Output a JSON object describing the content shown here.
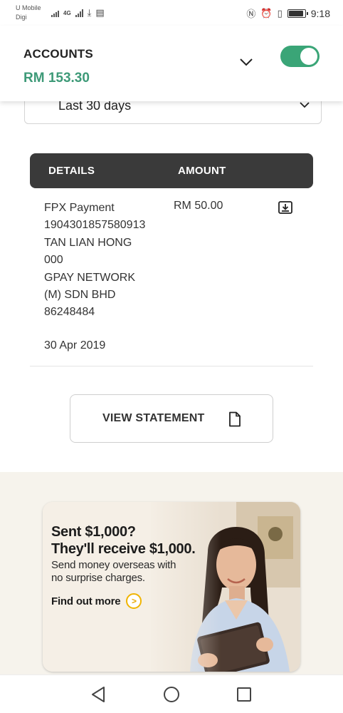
{
  "status_bar": {
    "carrier_1": "U Mobile",
    "carrier_2": "Digi",
    "network": "4G",
    "time": "9:18",
    "battery_level": 0.9
  },
  "account": {
    "title": "ACCOUNTS",
    "balance": "RM 153.30",
    "toggle_on": true
  },
  "filter": {
    "period": "Last 30 days"
  },
  "table": {
    "headers": [
      "DETAILS",
      "AMOUNT"
    ],
    "transaction": {
      "details": [
        "FPX Payment",
        "1904301857580913",
        "TAN LIAN HONG",
        "000",
        "GPAY NETWORK",
        "(M) SDN BHD",
        "86248484"
      ],
      "date": "30 Apr 2019",
      "amount": "RM 50.00"
    }
  },
  "actions": {
    "view_statement": "VIEW STATEMENT"
  },
  "promo": {
    "headline_1": "Sent $1,000?",
    "headline_2": "They'll receive $1,000.",
    "sub_1": "Send money overseas with",
    "sub_2": "no surprise charges.",
    "cta": "Find out more"
  },
  "colors": {
    "brand_green": "#3e9a78",
    "toggle_green": "#3aa577",
    "table_header": "#3a3a3a",
    "cta_accent": "#f0b400"
  },
  "icons": {
    "dropdown": "chevron-down-icon",
    "download": "download-icon",
    "statement": "document-icon",
    "cta": "chevron-right-icon",
    "nav_back": "back-triangle-icon",
    "nav_home": "home-circle-icon",
    "nav_recents": "recents-square-icon"
  }
}
